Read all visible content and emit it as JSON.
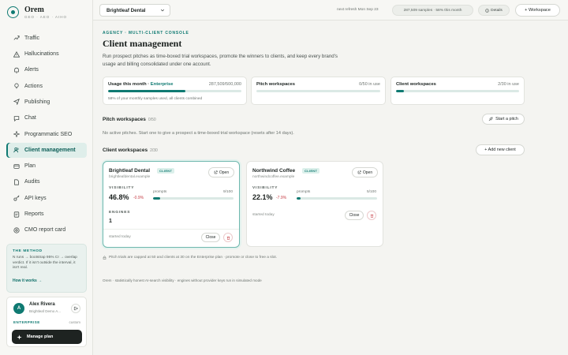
{
  "brand": {
    "name": "Orem",
    "tagline": "GEO · AEO · AIHO"
  },
  "nav": [
    {
      "label": "Traffic",
      "icon": "trending-up-icon"
    },
    {
      "label": "Hallucinations",
      "icon": "warning-icon"
    },
    {
      "label": "Alerts",
      "icon": "bell-icon"
    },
    {
      "label": "Actions",
      "icon": "lightbulb-icon"
    },
    {
      "label": "Publishing",
      "icon": "send-icon"
    },
    {
      "label": "Chat",
      "icon": "chat-icon"
    },
    {
      "label": "Programmatic SEO",
      "icon": "sparkle-icon"
    },
    {
      "label": "Client management",
      "icon": "users-icon",
      "active": true
    },
    {
      "label": "Plan",
      "icon": "wallet-icon"
    },
    {
      "label": "Audits",
      "icon": "file-icon"
    },
    {
      "label": "API keys",
      "icon": "key-icon"
    },
    {
      "label": "Reports",
      "icon": "report-icon"
    },
    {
      "label": "CMO report card",
      "icon": "target-icon"
    }
  ],
  "method": {
    "title": "THE METHOD",
    "body": "N runs → bootstrap 95% CI → overlap verdict. If it isn't outside the interval, it isn't real.",
    "link": "How it works →"
  },
  "user": {
    "initial": "A",
    "name": "Alex Rivera",
    "org": "Brightleaf Demo A...",
    "tier": "ENTERPRISE",
    "mode": "custom",
    "manage_label": "Manage plan"
  },
  "topbar": {
    "client_select": "Brightleaf Dental",
    "refresh": "next refresh Mon Sep 23",
    "samples": "287,509 samples · 58% this month",
    "details_label": "Details",
    "workspace_label": "+ Workspace"
  },
  "page": {
    "eyebrow": "AGENCY · MULTI-CLIENT CONSOLE",
    "title": "Client management",
    "description": "Run prospect pitches as time-boxed trial workspaces, promote the winners to clients, and keep every brand's usage and billing consolidated under one account."
  },
  "usage": {
    "label": "Usage this month · ",
    "tier": "Enterprise",
    "value": "287,509/500,000",
    "fraction": 0.58,
    "note": "58% of your monthly samples used, all clients combined"
  },
  "pitch_stat": {
    "label": "Pitch workspaces",
    "value": "0/50 in use",
    "fraction": 0
  },
  "client_stat": {
    "label": "Client workspaces",
    "value": "2/30 in use",
    "fraction": 0.067
  },
  "pitch_section": {
    "title": "Pitch workspaces",
    "count": "0/50",
    "button_label": "Start a pitch",
    "empty": "No active pitches. Start one to give a prospect a time-boxed trial workspace (resets after 14 days)."
  },
  "client_section": {
    "title": "Client workspaces",
    "count": "2/30",
    "button_label": "+ Add new client"
  },
  "labels": {
    "badge": "CLIENT",
    "open": "Open",
    "visibility": "VISIBILITY",
    "prompts": "prompts",
    "engines": "ENGINES",
    "started": "started today",
    "close": "Close"
  },
  "clients": [
    {
      "name": "Brightleaf Dental",
      "domain": "brightleafdental.example",
      "visibility": "46.8%",
      "delta": "-0.9%",
      "prompts": "9/100",
      "prompts_fraction": 0.09,
      "engines": "1"
    },
    {
      "name": "Northwind Coffee",
      "domain": "northwindcoffee.example",
      "visibility": "22.1%",
      "delta": "-7.9%",
      "prompts": "5/100",
      "prompts_fraction": 0.05
    }
  ],
  "cap_note": "Pitch trials are capped at 50 and clients at 30 on the Enterprise plan · promote or close to free a slot.",
  "footer": "Orem · statistically honest AI-search visibility · engines without provider keys run in simulated mode",
  "colors": {
    "accent": "#0f7a72",
    "negative": "#c7424a",
    "dark": "#1e2321"
  }
}
